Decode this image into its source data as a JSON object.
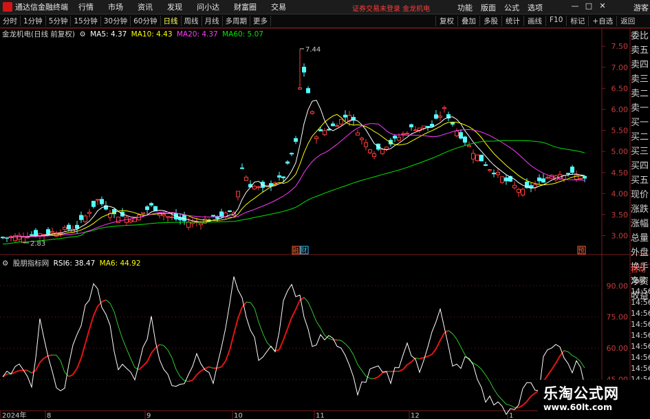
{
  "titlebar": {
    "app_title": "通达信金融终端",
    "menu": [
      "行情",
      "市场",
      "资讯",
      "发现",
      "问小达",
      "财富圈",
      "交易"
    ],
    "login_hint": "证券交易未登录   金龙机电",
    "right_menu": [
      "功能",
      "版面",
      "公式",
      "选项"
    ],
    "window_buttons": [
      "—",
      "□",
      "✕"
    ],
    "guest": "游客"
  },
  "period_tabs": [
    {
      "label": "分时",
      "active": false
    },
    {
      "label": "1分钟",
      "active": false
    },
    {
      "label": "5分钟",
      "active": false
    },
    {
      "label": "15分钟",
      "active": false
    },
    {
      "label": "30分钟",
      "active": false
    },
    {
      "label": "60分钟",
      "active": false
    },
    {
      "label": "日线",
      "active": true
    },
    {
      "label": "周线",
      "active": false
    },
    {
      "label": "月线",
      "active": false
    },
    {
      "label": "多周期",
      "active": false
    },
    {
      "label": "更多",
      "active": false
    }
  ],
  "toolbar_buttons": [
    "复权",
    "叠加",
    "多股",
    "统计",
    "画线",
    "F10",
    "标记",
    "+自选",
    "返回"
  ],
  "main_legend": {
    "stock": "金龙机电(日线 前复权)",
    "ma5": "MA5: 4.37",
    "ma10": "MA10: 4.43",
    "ma20": "MA20: 4.37",
    "ma60": "MA60: 5.07"
  },
  "rsi_legend": {
    "name": "股朋指标网",
    "rsi6": "RSI6: 38.47",
    "ma6": "MA6: 44.92"
  },
  "quote_panel": [
    "委比",
    "卖五",
    "卖四",
    "卖三",
    "卖二",
    "卖一",
    "买一",
    "买二",
    "买三",
    "买四",
    "买五",
    "现价",
    "涨跌",
    "涨幅",
    "总量",
    "外盘",
    "换手",
    "净资",
    "收益"
  ],
  "time_panel": [
    "自动",
    "交易",
    "14:56",
    "14:56",
    "14:56",
    "14:56",
    "14:56",
    "14:56",
    "14:56",
    "14:56",
    "14:56"
  ],
  "price_axis": [
    "7.50",
    "7.00",
    "6.50",
    "6.00",
    "5.50",
    "5.00",
    "4.50",
    "4.00",
    "3.50",
    "3.00"
  ],
  "rsi_axis": [
    "90.00",
    "75.00",
    "60.00",
    "45.00"
  ],
  "date_axis": [
    "2024年",
    "8",
    "9",
    "10",
    "11",
    "12",
    "1"
  ],
  "annotations": {
    "high": "7.44",
    "low": "2.83",
    "event1": "融",
    "event2": "财",
    "event3": "预"
  },
  "watermark": {
    "line1": "乐淘公式网",
    "line2": "www.60lt.com"
  },
  "colors": {
    "up": "#ff3c3c",
    "down": "#54ffff",
    "ma5": "#ffffff",
    "ma10": "#ffff00",
    "ma20": "#ff3cff",
    "ma60": "#00e600",
    "rsi6": "#ffffff",
    "ma6_up": "#e61414",
    "ma6_down": "#32c832",
    "grid": "#7a1c1c"
  }
}
